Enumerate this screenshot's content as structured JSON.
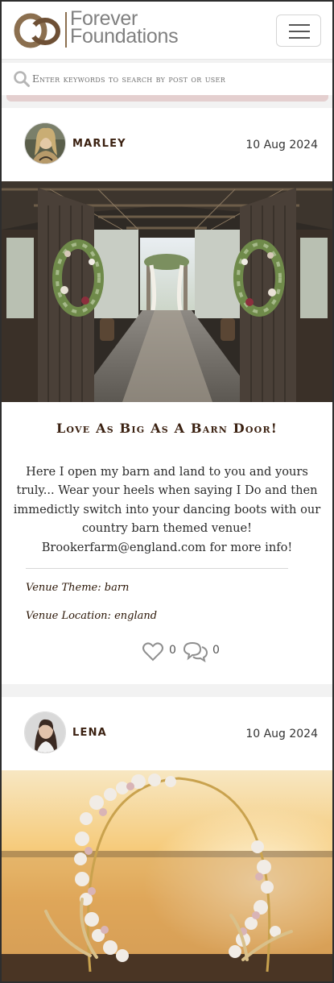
{
  "brand": {
    "line1": "Forever",
    "line2": "Foundations"
  },
  "nav": {
    "menu_icon": "hamburger-icon"
  },
  "search": {
    "placeholder": "Enter keywords to search by post or user",
    "icon": "search-icon"
  },
  "posts": [
    {
      "author": "MARLEY",
      "date": "10 Aug 2024",
      "title": "Love As Big As A Barn Door!",
      "body": "Here I open my barn and land to you and yours truly... Wear your heels when saying I Do and then immedictly switch into your dancing boots with our country barn themed venue! Brookerfarm@england.com for more info!",
      "theme_label": "Venue Theme:",
      "theme_value": "barn",
      "location_label": "Venue Location:",
      "location_value": "england",
      "likes": "0",
      "comments": "0"
    },
    {
      "author": "LENA",
      "date": "10 Aug 2024"
    }
  ],
  "colors": {
    "accent": "#8b6f4f",
    "title": "#3a2010",
    "search_bar_accent": "#e4cfcf"
  }
}
